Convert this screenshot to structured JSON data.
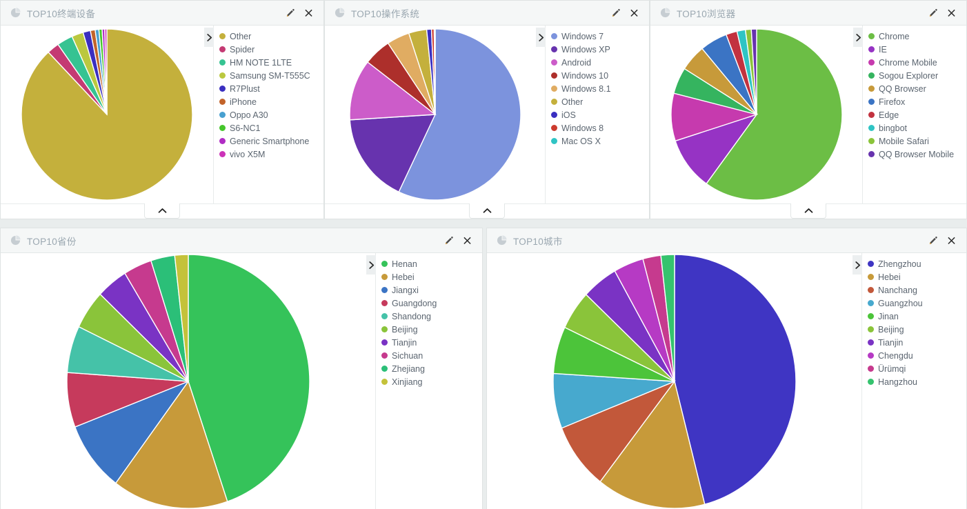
{
  "panels": [
    {
      "title": "TOP10终端设备",
      "icon": "pie-chart-icon",
      "edit_icon": "pencil-icon",
      "close_icon": "close-icon",
      "legend_toggle_icon": "chevron-right-icon",
      "collapse_icon": "chevron-up-icon"
    },
    {
      "title": "TOP10操作系统",
      "icon": "pie-chart-icon",
      "edit_icon": "pencil-icon",
      "close_icon": "close-icon",
      "legend_toggle_icon": "chevron-right-icon",
      "collapse_icon": "chevron-up-icon"
    },
    {
      "title": "TOP10浏览器",
      "icon": "pie-chart-icon",
      "edit_icon": "pencil-icon",
      "close_icon": "close-icon",
      "legend_toggle_icon": "chevron-right-icon",
      "collapse_icon": "chevron-up-icon"
    },
    {
      "title": "TOP10省份",
      "icon": "pie-chart-icon",
      "edit_icon": "pencil-icon",
      "close_icon": "close-icon",
      "legend_toggle_icon": "chevron-right-icon",
      "collapse_icon": "chevron-up-icon"
    },
    {
      "title": "TOP10城市",
      "icon": "pie-chart-icon",
      "edit_icon": "pencil-icon",
      "close_icon": "close-icon",
      "legend_toggle_icon": "chevron-right-icon",
      "collapse_icon": "chevron-up-icon"
    }
  ],
  "chart_data": [
    {
      "type": "pie",
      "title": "TOP10终端设备",
      "legend_position": "right",
      "categories": [
        "Other",
        "Spider",
        "HM NOTE 1LTE",
        "Samsung SM-T555C",
        "R7Plust",
        "iPhone",
        "Oppo A30",
        "S6-NC1",
        "Generic Smartphone",
        "vivo X5M"
      ],
      "values": [
        88.0,
        2.3,
        3.0,
        2.2,
        1.4,
        0.9,
        0.7,
        0.6,
        0.5,
        0.4
      ],
      "colors": [
        "#c4b03c",
        "#c43a73",
        "#36c392",
        "#bbc83f",
        "#3a2fc0",
        "#c2632a",
        "#48a0d0",
        "#45c62b",
        "#b02cc4",
        "#cc33b8"
      ]
    },
    {
      "type": "pie",
      "title": "TOP10操作系统",
      "legend_position": "right",
      "categories": [
        "Windows 7",
        "Windows XP",
        "Android",
        "Windows 10",
        "Windows 8.1",
        "Other",
        "iOS",
        "Windows 8",
        "Mac OS X"
      ],
      "values": [
        57.0,
        17.0,
        11.5,
        5.2,
        4.3,
        3.4,
        0.9,
        0.5,
        0.2
      ],
      "colors": [
        "#7c93dd",
        "#6733ae",
        "#cc5cc9",
        "#ad2f2b",
        "#e0ac62",
        "#c4b03c",
        "#3a2fc0",
        "#cc3b2e",
        "#2fc4c4"
      ]
    },
    {
      "type": "pie",
      "title": "TOP10浏览器",
      "legend_position": "right",
      "categories": [
        "Chrome",
        "IE",
        "Chrome Mobile",
        "Sogou Explorer",
        "QQ Browser",
        "Firefox",
        "Edge",
        "bingbot",
        "Mobile Safari",
        "QQ Browser Mobile"
      ],
      "values": [
        60.0,
        10.0,
        9.0,
        5.0,
        5.0,
        5.2,
        2.1,
        1.6,
        1.1,
        1.0
      ],
      "colors": [
        "#6cbe45",
        "#9633c4",
        "#c63aae",
        "#35b45f",
        "#c79a3a",
        "#3b74c4",
        "#c2323f",
        "#2fc4c4",
        "#8ac43a",
        "#6733ae"
      ]
    },
    {
      "type": "pie",
      "title": "TOP10省份",
      "legend_position": "right",
      "categories": [
        "Henan",
        "Hebei",
        "Jiangxi",
        "Guangdong",
        "Shandong",
        "Beijing",
        "Tianjin",
        "Sichuan",
        "Zhejiang",
        "Xinjiang"
      ],
      "values": [
        45.0,
        15.5,
        9.0,
        7.0,
        6.0,
        5.0,
        4.2,
        3.8,
        3.2,
        1.8
      ],
      "colors": [
        "#35c35a",
        "#c79a3a",
        "#3b74c4",
        "#c63a5c",
        "#45c2a8",
        "#8ac43a",
        "#7a33c4",
        "#c63a8e",
        "#2bbf78",
        "#c4c23a"
      ]
    },
    {
      "type": "pie",
      "title": "TOP10城市",
      "legend_position": "right",
      "categories": [
        "Zhengzhou",
        "Hebei",
        "Nanchang",
        "Guangzhou",
        "Jinan",
        "Beijing",
        "Tianjin",
        "Chengdu",
        "Ürümqi",
        "Hangzhou"
      ],
      "values": [
        46.0,
        14.5,
        8.5,
        7.0,
        6.0,
        5.0,
        4.8,
        4.0,
        2.4,
        1.8
      ],
      "colors": [
        "#3f35c3",
        "#c79a3a",
        "#c2583a",
        "#47a9ce",
        "#4cc43a",
        "#8ac43a",
        "#7a33c4",
        "#b63ac4",
        "#c63a8e",
        "#35c36e"
      ]
    }
  ],
  "theme": {
    "background": "#e9eded",
    "panel_bg": "#ffffff",
    "header_bg": "#f5f7f7",
    "title_color": "#9aa7b0",
    "legend_text": "#5b6570"
  }
}
